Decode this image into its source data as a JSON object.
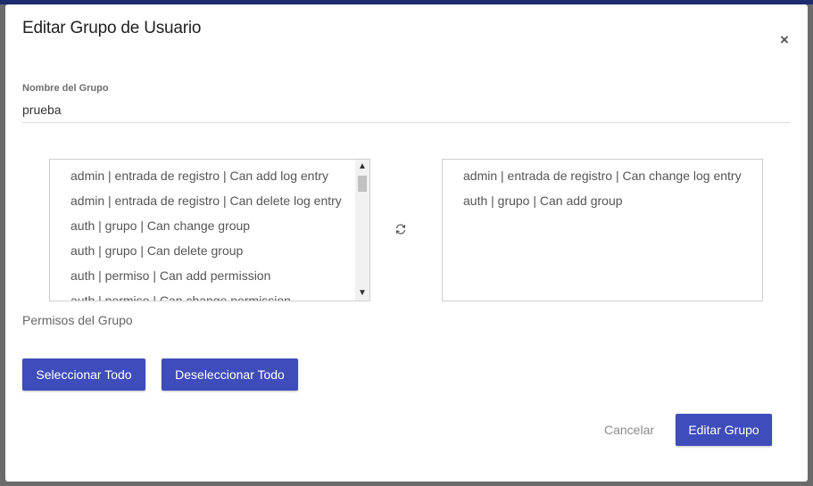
{
  "modal": {
    "title": "Editar Grupo de Usuario",
    "close_label": "×"
  },
  "form": {
    "name_label": "Nombre del Grupo",
    "name_value": "prueba",
    "permissions_caption": "Permisos del Grupo"
  },
  "available_permissions": [
    "admin | entrada de registro | Can add log entry",
    "admin | entrada de registro | Can delete log entry",
    "auth | grupo | Can change group",
    "auth | grupo | Can delete group",
    "auth | permiso | Can add permission",
    "auth | permiso | Can change permission"
  ],
  "selected_permissions": [
    "admin | entrada de registro | Can change log entry",
    "auth | grupo | Can add group"
  ],
  "icons": {
    "swap": "swap-icon",
    "close": "close-icon",
    "scroll_up": "▲",
    "scroll_down": "▼"
  },
  "buttons": {
    "select_all": "Seleccionar Todo",
    "deselect_all": "Deseleccionar Todo",
    "cancel": "Cancelar",
    "submit": "Editar Grupo"
  },
  "colors": {
    "primary": "#3f4cbb",
    "topbar": "#1e2b6e"
  }
}
